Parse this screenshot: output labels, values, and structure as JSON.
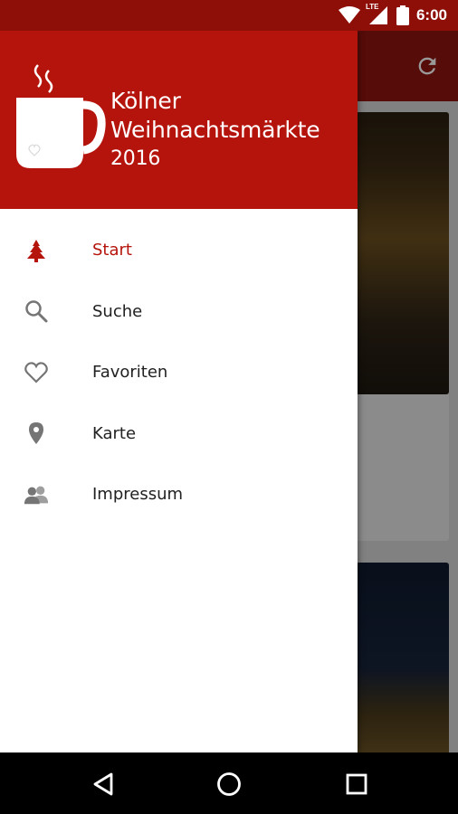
{
  "status_bar": {
    "time": "6:00",
    "network_label": "LTE",
    "icons": [
      "wifi-icon",
      "signal-icon",
      "battery-icon"
    ]
  },
  "drawer": {
    "header": {
      "title_line1": "Kölner",
      "title_line2": "Weihnachtsmärkte",
      "year": "2016",
      "logo_icon": "mug-icon"
    },
    "items": [
      {
        "label": "Start",
        "icon": "tree-icon",
        "active": true
      },
      {
        "label": "Suche",
        "icon": "search-icon",
        "active": false
      },
      {
        "label": "Favoriten",
        "icon": "heart-icon",
        "active": false
      },
      {
        "label": "Karte",
        "icon": "map-pin-icon",
        "active": false
      },
      {
        "label": "Impressum",
        "icon": "people-icon",
        "active": false
      }
    ]
  },
  "background_app": {
    "toolbar_action_icon": "refresh-icon"
  },
  "nav_bar": {
    "buttons": [
      "back-icon",
      "home-icon",
      "recents-icon"
    ]
  },
  "colors": {
    "status_bar": "#8e0f08",
    "drawer_header": "#b5140c",
    "accent": "#b5140c",
    "icon_gray": "#757575"
  }
}
